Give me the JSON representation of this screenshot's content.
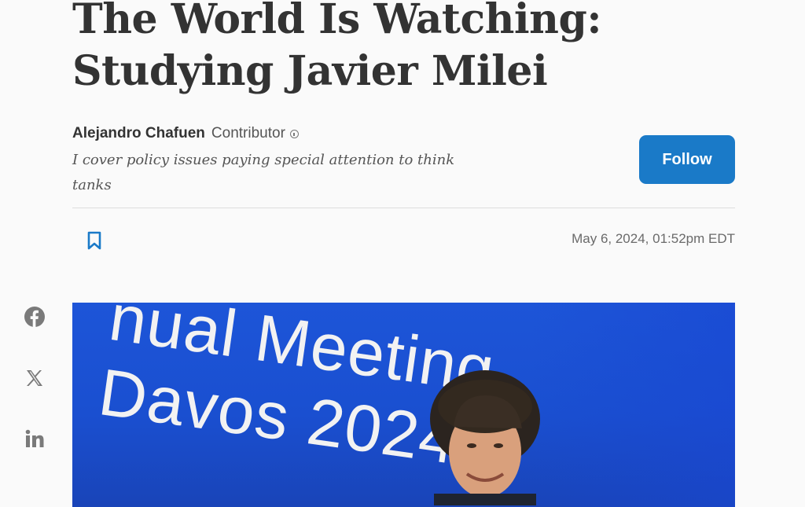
{
  "article": {
    "headline_line1": "The World Is Watching:",
    "headline_line2": "Studying Javier Milei",
    "author_name": "Alejandro Chafuen",
    "author_role": "Contributor",
    "author_bio": "I cover policy issues paying special attention to think tanks",
    "follow_label": "Follow",
    "timestamp": "May 6, 2024, 01:52pm EDT"
  },
  "share": {
    "icons": [
      "facebook-icon",
      "x-icon",
      "linkedin-icon"
    ]
  },
  "hero": {
    "text_line1": "nual Meeting",
    "text_line2": "Davos 2024"
  },
  "colors": {
    "accent": "#1a7ac8",
    "hero_bg": "#1d55d8"
  }
}
